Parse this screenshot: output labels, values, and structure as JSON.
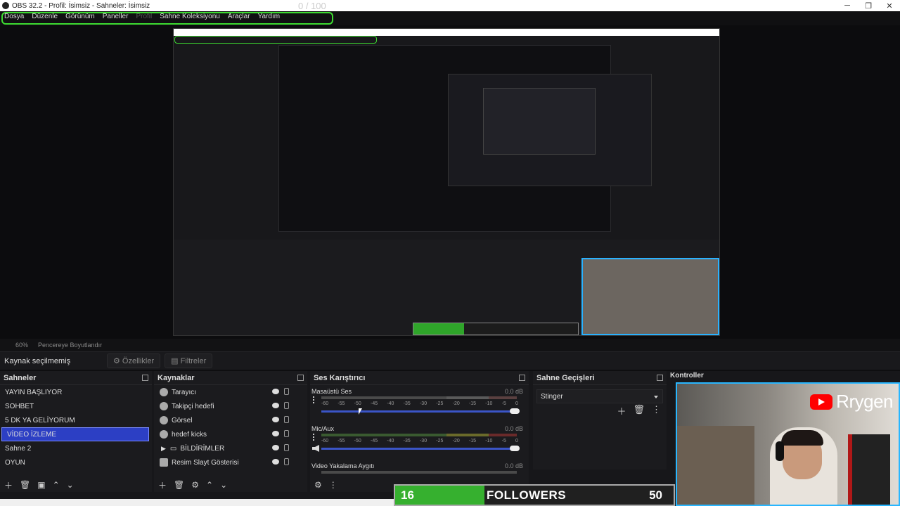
{
  "window": {
    "title": "OBS 32.2 - Profil: İsimsiz - Sahneler: İsimsiz",
    "ghost_counter": "0 / 100",
    "controls": [
      "─",
      "❐",
      "✕"
    ]
  },
  "menu": [
    "Dosya",
    "Düzenle",
    "Görünüm",
    "Paneller",
    "Profil",
    "Sahne Koleksiyonu",
    "Araçlar",
    "Yardım"
  ],
  "zoombar": {
    "zoom": "60%",
    "fit_label": "Pencereye Boyutlandır"
  },
  "sourcebar": {
    "no_source": "Kaynak seçilmemiş",
    "properties": "Özellikler",
    "filters": "Filtreler"
  },
  "scenes": {
    "title": "Sahneler",
    "items": [
      "YAYIN BAŞLIYOR",
      "SOHBET",
      "5 DK YA GELİYORUM",
      "VİDEO İZLEME",
      "Sahne 2",
      "OYUN"
    ],
    "selected_index": 3
  },
  "sources": {
    "title": "Kaynaklar",
    "items": [
      "Tarayıcı",
      "Takipçi hedefi",
      "Görsel",
      "hedef kicks",
      "BİLDİRİMLER",
      "Resim Slayt Gösterisi"
    ]
  },
  "mixer": {
    "title": "Ses Karıştırıcı",
    "channels": [
      {
        "name": "Masaüstü Ses",
        "db": "0.0 dB"
      },
      {
        "name": "Mic/Aux",
        "db": "0.0 dB"
      },
      {
        "name": "Video Yakalama Aygıtı",
        "db": "0.0 dB"
      }
    ],
    "ticks": [
      "-60",
      "-55",
      "-50",
      "-45",
      "-40",
      "-35",
      "-30",
      "-25",
      "-20",
      "-15",
      "-10",
      "-5",
      "0"
    ]
  },
  "transitions": {
    "title": "Sahne Geçişleri",
    "selected": "Stinger"
  },
  "controls": {
    "title": "Kontroller"
  },
  "overlay": {
    "channel_name": "Rrygen",
    "followers_current": "16",
    "followers_label": "FOLLOWERS",
    "followers_goal": "50",
    "progress": 0.32,
    "accent": "#3ddc31",
    "brand_red": "#ff0000"
  }
}
